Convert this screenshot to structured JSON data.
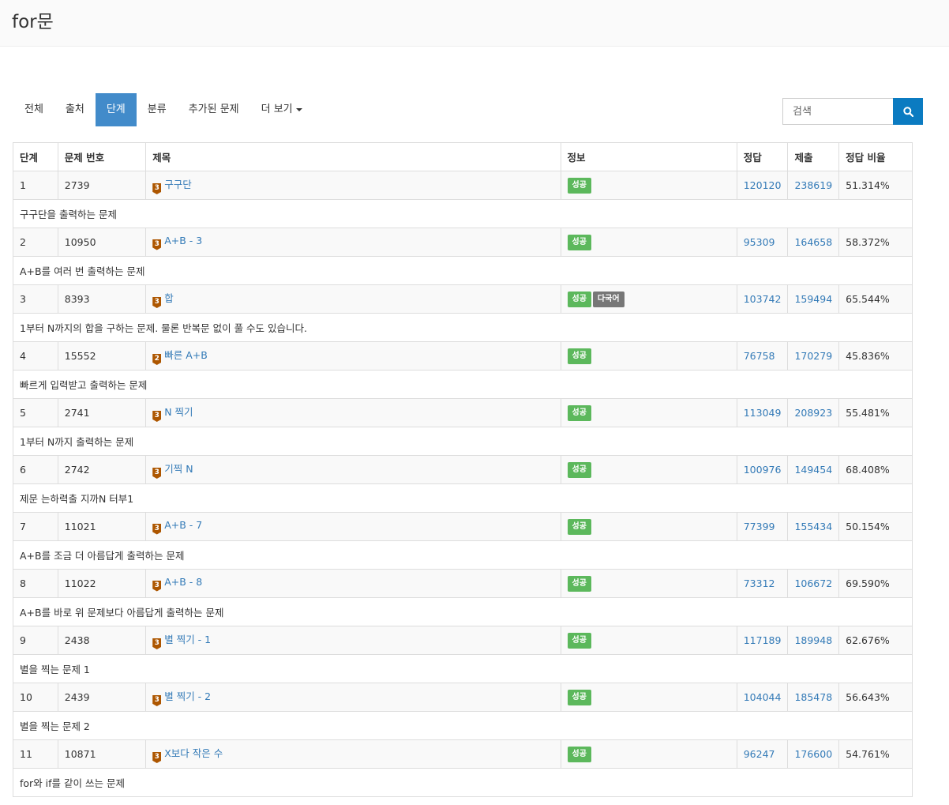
{
  "header": {
    "title": "for문"
  },
  "tabs": [
    {
      "label": "전체"
    },
    {
      "label": "출처"
    },
    {
      "label": "단계"
    },
    {
      "label": "분류"
    },
    {
      "label": "추가된 문제"
    },
    {
      "label": "더 보기"
    }
  ],
  "search": {
    "placeholder": "검색"
  },
  "table": {
    "headers": [
      "단계",
      "문제 번호",
      "제목",
      "정보",
      "정답",
      "제출",
      "정답 비율"
    ],
    "rows": [
      {
        "step": "1",
        "id": "2739",
        "tier": "3",
        "title": "구구단",
        "labels": [
          "성공"
        ],
        "correct": "120120",
        "submit": "238619",
        "ratio": "51.314%",
        "desc": "구구단을 출력하는 문제"
      },
      {
        "step": "2",
        "id": "10950",
        "tier": "3",
        "title": "A+B - 3",
        "labels": [
          "성공"
        ],
        "correct": "95309",
        "submit": "164658",
        "ratio": "58.372%",
        "desc": "A+B를 여러 번 출력하는 문제"
      },
      {
        "step": "3",
        "id": "8393",
        "tier": "3",
        "title": "합",
        "labels": [
          "성공",
          "다국어"
        ],
        "correct": "103742",
        "submit": "159494",
        "ratio": "65.544%",
        "desc": "1부터 N까지의 합을 구하는 문제. 물론 반복문 없이 풀 수도 있습니다."
      },
      {
        "step": "4",
        "id": "15552",
        "tier": "2",
        "title": "빠른 A+B",
        "labels": [
          "성공"
        ],
        "correct": "76758",
        "submit": "170279",
        "ratio": "45.836%",
        "desc": "빠르게 입력받고 출력하는 문제"
      },
      {
        "step": "5",
        "id": "2741",
        "tier": "3",
        "title": "N 찍기",
        "labels": [
          "성공"
        ],
        "correct": "113049",
        "submit": "208923",
        "ratio": "55.481%",
        "desc": "1부터 N까지 출력하는 문제"
      },
      {
        "step": "6",
        "id": "2742",
        "tier": "3",
        "title": "기찍 N",
        "labels": [
          "성공"
        ],
        "correct": "100976",
        "submit": "149454",
        "ratio": "68.408%",
        "desc": "제문 는하력출 지까N 터부1"
      },
      {
        "step": "7",
        "id": "11021",
        "tier": "3",
        "title": "A+B - 7",
        "labels": [
          "성공"
        ],
        "correct": "77399",
        "submit": "155434",
        "ratio": "50.154%",
        "desc": "A+B를 조금 더 아름답게 출력하는 문제"
      },
      {
        "step": "8",
        "id": "11022",
        "tier": "3",
        "title": "A+B - 8",
        "labels": [
          "성공"
        ],
        "correct": "73312",
        "submit": "106672",
        "ratio": "69.590%",
        "desc": "A+B를 바로 위 문제보다 아름답게 출력하는 문제"
      },
      {
        "step": "9",
        "id": "2438",
        "tier": "3",
        "title": "별 찍기 - 1",
        "labels": [
          "성공"
        ],
        "correct": "117189",
        "submit": "189948",
        "ratio": "62.676%",
        "desc": "별을 찍는 문제 1"
      },
      {
        "step": "10",
        "id": "2439",
        "tier": "3",
        "title": "별 찍기 - 2",
        "labels": [
          "성공"
        ],
        "correct": "104044",
        "submit": "185478",
        "ratio": "56.643%",
        "desc": "별을 찍는 문제 2"
      },
      {
        "step": "11",
        "id": "10871",
        "tier": "3",
        "title": "X보다 작은 수",
        "labels": [
          "성공"
        ],
        "correct": "96247",
        "submit": "176600",
        "ratio": "54.761%",
        "desc": "for와 if를 같이 쓰는 문제"
      }
    ]
  }
}
